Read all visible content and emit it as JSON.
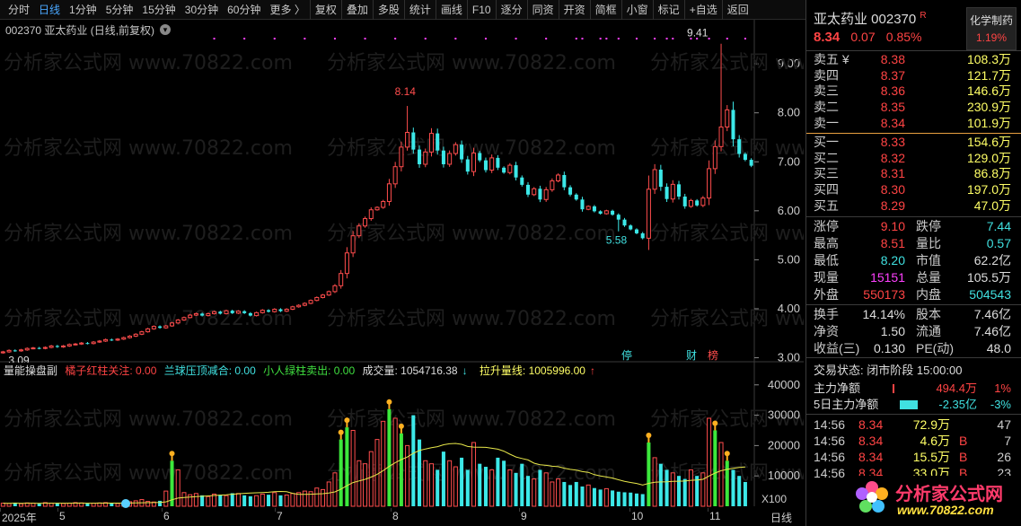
{
  "toolbar": {
    "items": [
      {
        "label": "分时",
        "active": false
      },
      {
        "label": "日线",
        "active": true
      },
      {
        "label": "1分钟",
        "active": false
      },
      {
        "label": "5分钟",
        "active": false
      },
      {
        "label": "15分钟",
        "active": false
      },
      {
        "label": "30分钟",
        "active": false
      },
      {
        "label": "60分钟",
        "active": false
      },
      {
        "label": "更多 〉",
        "active": false
      },
      {
        "label": "复权",
        "active": false
      },
      {
        "label": "叠加",
        "active": false
      },
      {
        "label": "多股",
        "active": false
      },
      {
        "label": "统计",
        "active": false
      },
      {
        "label": "画线",
        "active": false
      },
      {
        "label": "F10",
        "active": false
      },
      {
        "label": "逐分",
        "active": false
      },
      {
        "label": "同资",
        "active": false
      },
      {
        "label": "开资",
        "active": false
      },
      {
        "label": "简框",
        "active": false
      },
      {
        "label": "小窗",
        "active": false
      },
      {
        "label": "标记",
        "active": false
      },
      {
        "label": "+自选",
        "active": false
      },
      {
        "label": "返回",
        "active": false
      }
    ]
  },
  "chart": {
    "title": "002370 亚太药业 (日线,前复权)",
    "watermark": "分析家公式网 www.70822.com",
    "colors": {
      "up": "#ff4d4d",
      "down": "#3ce8e8",
      "ma": "#e8e84a",
      "grid": "#3a3a3a",
      "magenta": "#ff40ff"
    }
  },
  "chart_data": {
    "type": "candlestick",
    "ylim": [
      2.9,
      9.9
    ],
    "yticks": [
      "9.00",
      "8.00",
      "7.00",
      "6.00",
      "5.00",
      "4.00",
      "3.00"
    ],
    "annotations": [
      "8.14",
      "5.58",
      "9.41",
      "3.09"
    ],
    "markers": [
      "停",
      "财",
      "榜"
    ],
    "start_price": 3.1,
    "deltas": [
      0.02,
      0.03,
      -0.01,
      0.02,
      0.03,
      0.01,
      -0.01,
      0.02,
      0.03,
      -0.02,
      0.02,
      0.03,
      0.01,
      0.02,
      -0.01,
      0.03,
      0.02,
      0.03,
      -0.01,
      0.02,
      0.03,
      0.03,
      0.04,
      0.05,
      0.06,
      0.05,
      -0.03,
      0.04,
      0.06,
      0.06,
      0.05,
      0.05,
      0.03,
      -0.04,
      0.04,
      0.04,
      -0.04,
      0.06,
      -0.05,
      0.04,
      -0.04,
      -0.05,
      0.06,
      0.05,
      -0.03,
      0.05,
      -0.04,
      0.04,
      0.05,
      0.03,
      0.04,
      0.06,
      0.06,
      0.05,
      0.07,
      0.12,
      0.25,
      0.42,
      0.35,
      0.2,
      0.15,
      0.18,
      0.05,
      0.12,
      0.36,
      0.35,
      0.4,
      0.3,
      -0.35,
      -0.3,
      0.25,
      0.38,
      -0.35,
      -0.28,
      0.22,
      0.18,
      -0.3,
      -0.25,
      0.38,
      -0.15,
      -0.2,
      0.25,
      -0.2,
      -0.1,
      0.15,
      -0.25,
      -0.15,
      -0.2,
      0.12,
      -0.22,
      0.2,
      0.18,
      0.12,
      -0.25,
      -0.15,
      -0.1,
      -0.2,
      0.06,
      -0.1,
      -0.05,
      0.06,
      -0.08,
      -0.1,
      -0.12,
      -0.08,
      -0.08,
      -0.1,
      1.0,
      0.4,
      -0.35,
      -0.25,
      0.3,
      -0.25,
      -0.2,
      0.12,
      -0.1,
      0.15,
      0.6,
      0.45,
      0.4,
      0.35,
      -0.6,
      -0.3,
      -0.12,
      -0.12
    ],
    "volumes": [
      1000,
      900,
      1200,
      800,
      1100,
      1000,
      900,
      1200,
      1000,
      1100,
      900,
      1000,
      1200,
      1100,
      900,
      1000,
      1100,
      1200,
      1000,
      900,
      1100,
      1500,
      1800,
      2200,
      1600,
      1400,
      1800,
      5000,
      15000,
      12000,
      4500,
      3800,
      4200,
      3600,
      3200,
      4000,
      3800,
      3500,
      4300,
      4200,
      3600,
      3300,
      3500,
      4000,
      3800,
      4500,
      3600,
      3700,
      4200,
      4500,
      5000,
      4800,
      6000,
      5500,
      8000,
      11000,
      22000,
      26000,
      25000,
      15000,
      14000,
      18000,
      22000,
      28000,
      32000,
      29000,
      24000,
      20000,
      30000,
      22000,
      15000,
      14000,
      12000,
      18000,
      15000,
      13000,
      16000,
      12000,
      21000,
      14000,
      13000,
      12000,
      16000,
      15000,
      12000,
      11000,
      14000,
      10000,
      9000,
      12000,
      11000,
      8000,
      9000,
      8000,
      7000,
      8000,
      6500,
      7000,
      6000,
      5500,
      5800,
      5200,
      4800,
      4600,
      4500,
      4200,
      4000,
      21000,
      16000,
      14000,
      12000,
      11000,
      10000,
      9000,
      12000,
      10000,
      11000,
      29000,
      25000,
      21000,
      15000,
      12000,
      10000,
      8000
    ],
    "vol_ylim": [
      0,
      42000
    ],
    "vol_yticks": [
      "40000",
      "30000",
      "20000",
      "10000"
    ],
    "vol_unit": "X100",
    "signal_days": [
      28,
      56,
      57,
      64,
      66,
      107,
      118,
      120
    ],
    "dates": [
      "2025年",
      "5",
      "6",
      "7",
      "8",
      "9",
      "10",
      "11"
    ],
    "period_label": "日线"
  },
  "vol_panel": {
    "name": "量能操盘副",
    "s1": "橘子红柱关注: 0.00",
    "s2": "兰球压顶减合: 0.00",
    "s3": "小人绿柱卖出: 0.00",
    "s4": "成交量: 1054716.38",
    "s4_arrow": "↓",
    "s5": "拉升量线: 1005996.00",
    "s5_arrow": "↑"
  },
  "quote": {
    "name": "亚太药业 002370",
    "r_badge": "R",
    "sector_name": "化学制药",
    "sector_pct": "1.19%",
    "price": "8.34",
    "change": "0.07",
    "change_pct": "0.85%",
    "asks": [
      {
        "label": "卖五 ¥",
        "price": "8.38",
        "vol": "108.3万"
      },
      {
        "label": "卖四",
        "price": "8.37",
        "vol": "121.7万"
      },
      {
        "label": "卖三",
        "price": "8.36",
        "vol": "146.6万"
      },
      {
        "label": "卖二",
        "price": "8.35",
        "vol": "230.9万"
      },
      {
        "label": "卖一",
        "price": "8.34",
        "vol": "101.9万"
      }
    ],
    "bids": [
      {
        "label": "买一",
        "price": "8.33",
        "vol": "154.6万"
      },
      {
        "label": "买二",
        "price": "8.32",
        "vol": "129.0万"
      },
      {
        "label": "买三",
        "price": "8.31",
        "vol": "86.8万"
      },
      {
        "label": "买四",
        "price": "8.30",
        "vol": "197.0万"
      },
      {
        "label": "买五",
        "price": "8.29",
        "vol": "47.0万"
      }
    ],
    "stats1": [
      {
        "a": "涨停",
        "b": "9.10",
        "bc": "red",
        "c": "跌停",
        "d": "7.44",
        "dc": "cy"
      },
      {
        "a": "最高",
        "b": "8.51",
        "bc": "red",
        "c": "量比",
        "d": "0.57",
        "dc": "cy"
      },
      {
        "a": "最低",
        "b": "8.20",
        "bc": "cy",
        "c": "市值",
        "d": "62.2亿",
        "dc": "wh"
      },
      {
        "a": "现量",
        "b": "15151",
        "bc": "mg",
        "c": "总量",
        "d": "105.5万",
        "dc": "wh"
      },
      {
        "a": "外盘",
        "b": "550173",
        "bc": "red",
        "c": "内盘",
        "d": "504543",
        "dc": "cy"
      }
    ],
    "stats2": [
      {
        "a": "换手",
        "b": "14.14%",
        "bc": "wh",
        "c": "股本",
        "d": "7.46亿",
        "dc": "wh"
      },
      {
        "a": "净资",
        "b": "1.50",
        "bc": "wh",
        "c": "流通",
        "d": "7.46亿",
        "dc": "wh"
      },
      {
        "a": "收益(三)",
        "b": "0.130",
        "bc": "wh",
        "c": "PE(动)",
        "d": "48.0",
        "dc": "wh"
      }
    ],
    "trade_status": "交易状态: 闭市阶段 15:00:00",
    "flow": [
      {
        "label": "主力净额",
        "value": "494.4万",
        "pct": "1%",
        "color": "red",
        "bar_ratio": 0.02
      },
      {
        "label": "5日主力净额",
        "value": "-2.35亿",
        "pct": "-3%",
        "color": "cy",
        "bar_ratio": 0.25
      }
    ],
    "ticks": [
      {
        "t": "14:56",
        "p": "8.34",
        "v": "72.9万",
        "bs": "",
        "n": "47"
      },
      {
        "t": "14:56",
        "p": "8.34",
        "v": "4.6万",
        "bs": "B",
        "n": "7"
      },
      {
        "t": "14:56",
        "p": "8.34",
        "v": "15.5万",
        "bs": "B",
        "n": "26"
      },
      {
        "t": "14:56",
        "p": "8.34",
        "v": "33.0万",
        "bs": "B",
        "n": "23"
      }
    ]
  },
  "logo": {
    "text": "分析家公式网",
    "url": "www.70822.com"
  }
}
